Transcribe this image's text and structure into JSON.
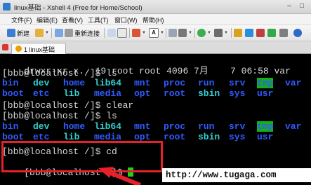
{
  "window": {
    "title": "linux基础 - Xshell 4 (Free for Home/School)"
  },
  "menu": [
    "文件(F)",
    "编辑(E)",
    "查看(V)",
    "工具(T)",
    "窗口(W)",
    "帮助(H)"
  ],
  "toolbar": {
    "new_label": "新建",
    "reconnect_label": "重新连接"
  },
  "tab": {
    "label": "1 linux基础"
  },
  "terminal": {
    "line0": "drwxr-xr-x.  19 root root 4096 7月    7 06:58 var",
    "prompt1": "[bbb@localhost /]$ ls",
    "ls1_row1": [
      "bin",
      "dev",
      "home",
      "lib64",
      "mnt",
      "proc",
      "run",
      "srv",
      "tmp",
      "var"
    ],
    "ls1_row2": [
      "boot",
      "etc",
      "lib",
      "media",
      "opt",
      "root",
      "sbin",
      "sys",
      "usr"
    ],
    "prompt2": "[bbb@localhost /]$ clear",
    "prompt3": "[bbb@localhost /]$ ls",
    "ls2_row1": [
      "bin",
      "dev",
      "home",
      "lib64",
      "mnt",
      "proc",
      "run",
      "srv",
      "tmp",
      "var"
    ],
    "ls2_row2": [
      "boot",
      "etc",
      "lib",
      "media",
      "opt",
      "root",
      "sbin",
      "sys",
      "usr"
    ],
    "prompt4": "[bbb@localhost /]$ cd",
    "prompt5": "[bbb@localhost ~]$ "
  },
  "watermark": "http://www.tugaga.com",
  "colors": {
    "highlight": "#e8202a",
    "dir_blue": "#2f5bff",
    "link_cyan": "#32d0d0",
    "tmp_bg": "#13b113",
    "cursor": "#16d816"
  }
}
